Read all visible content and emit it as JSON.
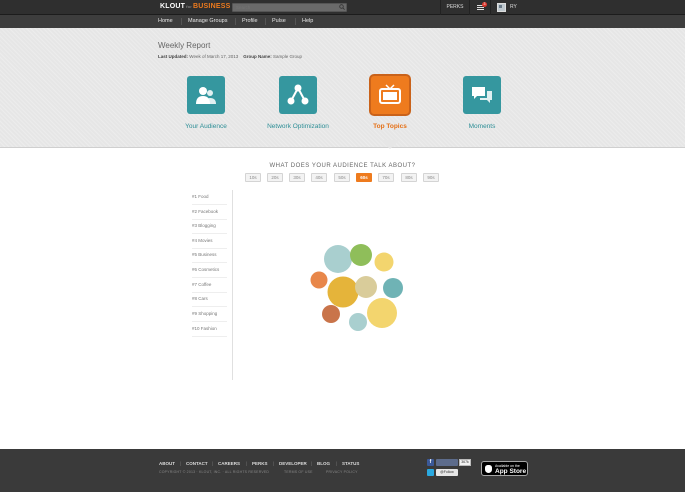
{
  "header": {
    "logo_main": "KLOUT",
    "logo_for": "for",
    "logo_business": "BUSINESS",
    "search_placeholder": "Search",
    "perks_label": "PERKS",
    "notification_count": "3",
    "user_initials": "RY"
  },
  "nav": {
    "items": [
      {
        "label": "Home"
      },
      {
        "label": "Manage Groups"
      },
      {
        "label": "Profile"
      },
      {
        "label": "Pulse"
      },
      {
        "label": "Help"
      }
    ]
  },
  "report": {
    "title": "Weekly Report",
    "last_updated_label": "Last Updated:",
    "last_updated_value": "Week of March 17, 2013",
    "group_name_label": "Group Name:",
    "group_name_value": "Sample Group",
    "tiles": [
      {
        "label": "Your Audience",
        "icon": "audience-icon",
        "active": false
      },
      {
        "label": "Network Optimization",
        "icon": "network-icon",
        "active": false
      },
      {
        "label": "Top Topics",
        "icon": "tv-icon",
        "active": true
      },
      {
        "label": "Moments",
        "icon": "speech-bubbles-icon",
        "active": false
      }
    ]
  },
  "main": {
    "question": "WHAT DOES YOUR AUDIENCE TALK ABOUT?",
    "age_filters": [
      "10s",
      "20s",
      "30s",
      "40s",
      "50s",
      "60s",
      "70s",
      "80s",
      "90s"
    ],
    "active_age": "60s",
    "topics": [
      {
        "label": "#1 Food"
      },
      {
        "label": "#2 Facebook"
      },
      {
        "label": "#3 Blogging"
      },
      {
        "label": "#4 Movies"
      },
      {
        "label": "#5 Business"
      },
      {
        "label": "#6 Cosmetics"
      },
      {
        "label": "#7 Coffee"
      },
      {
        "label": "#8 Cars"
      },
      {
        "label": "#9 Shopping"
      },
      {
        "label": "#10 Fashion"
      }
    ],
    "bubble_colors": {
      "teal_light": "#a9cfcf",
      "green": "#8fbe5a",
      "yellow": "#f3d56e",
      "orange": "#e8874a",
      "gold": "#e5b43a",
      "khaki": "#d9cc9a",
      "teal": "#6fb3b5",
      "rust": "#c9744a"
    }
  },
  "footer": {
    "links": [
      {
        "label": "ABOUT"
      },
      {
        "label": "CONTACT"
      },
      {
        "label": "CAREERS"
      },
      {
        "label": "PERKS"
      },
      {
        "label": "DEVELOPER"
      },
      {
        "label": "BLOG"
      },
      {
        "label": "STATUS"
      }
    ],
    "copyright": "COPYRIGHT © 2013 · KLOUT, INC. · ALL RIGHTS RESERVED",
    "terms": "TERMS OF USE",
    "privacy": "PRIVACY POLICY",
    "facebook_count": "367k",
    "twitter_follow": "@Follow",
    "appstore_small": "Available on the",
    "appstore_big": "App Store"
  },
  "colors": {
    "accent": "#ee7b1e",
    "teal": "#35979f",
    "topbar": "#2f2f2f"
  }
}
